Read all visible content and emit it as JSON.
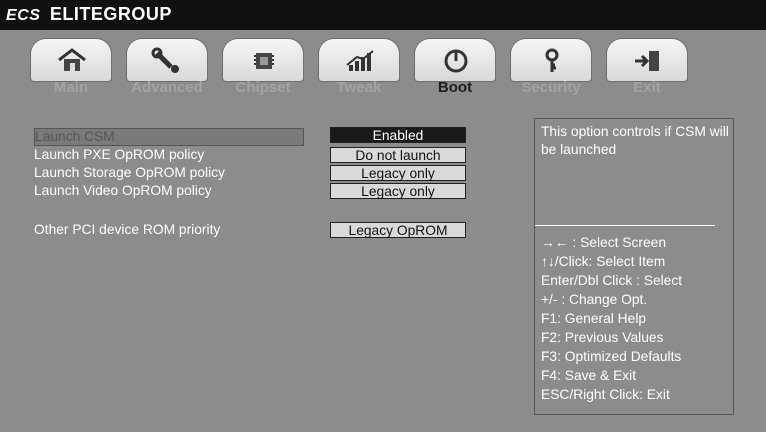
{
  "brand": {
    "logo": "ECS",
    "name": "ELITEGROUP"
  },
  "tabs": [
    {
      "label": "Main",
      "icon": "home-icon"
    },
    {
      "label": "Advanced",
      "icon": "wrench-icon"
    },
    {
      "label": "Chipset",
      "icon": "chip-icon"
    },
    {
      "label": "Tweak",
      "icon": "chart-icon"
    },
    {
      "label": "Boot",
      "icon": "power-icon",
      "active": true
    },
    {
      "label": "Security",
      "icon": "key-icon"
    },
    {
      "label": "Exit",
      "icon": "exit-icon"
    }
  ],
  "settings": [
    {
      "label": "Launch CSM",
      "value": "Enabled"
    },
    {
      "label": "Launch PXE OpROM policy",
      "value": "Do not launch"
    },
    {
      "label": "Launch Storage OpROM policy",
      "value": "Legacy only"
    },
    {
      "label": "Launch Video OpROM policy",
      "value": "Legacy only"
    },
    {
      "label": "Other PCI device ROM priority",
      "value": "Legacy OpROM"
    }
  ],
  "help": {
    "description": "This option controls if CSM will be launched",
    "keys": [
      "→←  : Select Screen",
      "↑↓/Click: Select Item",
      "Enter/Dbl Click : Select",
      "+/- : Change Opt.",
      "F1: General Help",
      "F2: Previous Values",
      "F3: Optimized Defaults",
      "F4: Save & Exit",
      "ESC/Right Click: Exit"
    ]
  }
}
